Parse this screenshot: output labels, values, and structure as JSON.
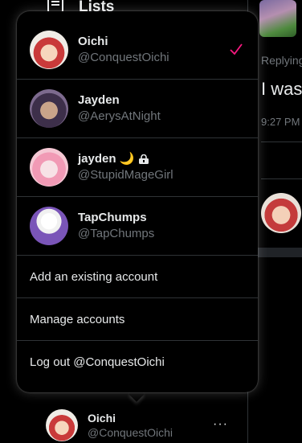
{
  "nav": {
    "lists_label": "Lists"
  },
  "right": {
    "replying_text": "Replying",
    "tweet_text": "I was",
    "time_text": "9:27 PM"
  },
  "menu": {
    "accounts": [
      {
        "name": "Oichi",
        "handle": "@ConquestOichi",
        "selected": true
      },
      {
        "name": "Jayden",
        "handle": "@AerysAtNight",
        "selected": false
      },
      {
        "name": "jayden 🌙",
        "handle": "@StupidMageGirl",
        "selected": false,
        "protected": true
      },
      {
        "name": "TapChumps",
        "handle": "@TapChumps",
        "selected": false
      }
    ],
    "add_existing": "Add an existing account",
    "manage": "Manage accounts",
    "logout": "Log out @ConquestOichi"
  },
  "current_account": {
    "name": "Oichi",
    "handle": "@ConquestOichi",
    "more": "···"
  },
  "colors": {
    "accent": "#f91880",
    "border": "#2f3336",
    "muted": "#71767b",
    "text": "#e7e9ea"
  },
  "icons": {
    "lists": "lists-icon",
    "check": "check-icon",
    "lock": "lock-icon",
    "more": "more-icon"
  }
}
